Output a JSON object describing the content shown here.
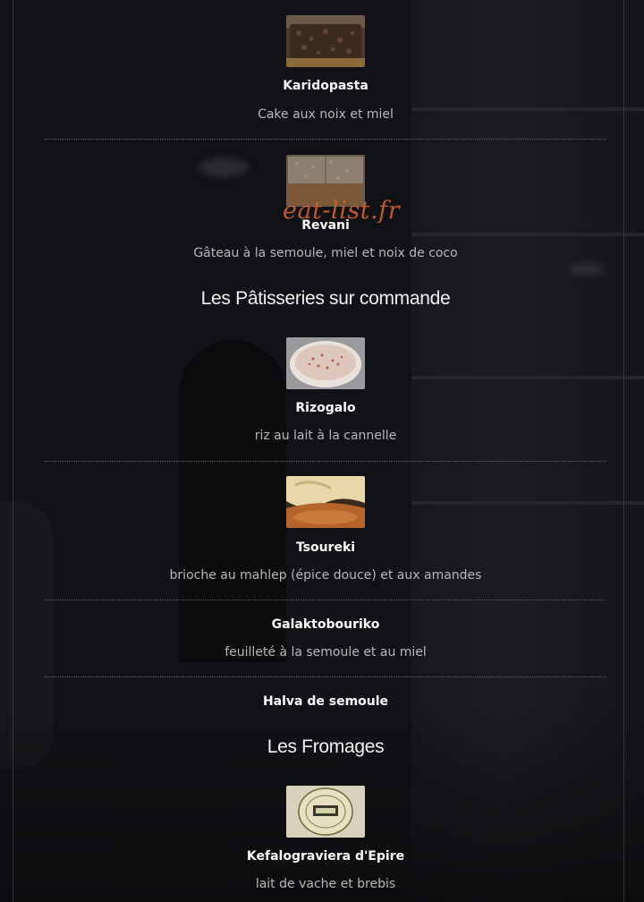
{
  "watermark": "eat-list.fr",
  "sections": [
    {
      "title": "Les Pâtisseries sur commande"
    },
    {
      "title": "Les Fromages"
    }
  ],
  "items": [
    {
      "name": "Karidopasta",
      "desc": "Cake aux noix et miel",
      "image": "walnut-cake-photo"
    },
    {
      "name": "Revani",
      "desc": "Gâteau à la semoule, miel et noix de coco",
      "image": "semolina-cake-photo"
    },
    {
      "name": "Rizogalo",
      "desc": "riz au lait à la cannelle",
      "image": "rice-pudding-photo"
    },
    {
      "name": "Tsoureki",
      "desc": "brioche au mahlep (épice douce) et aux amandes",
      "image": "brioche-photo"
    },
    {
      "name": "Galaktobouriko",
      "desc": "feuilleté à la semoule et au miel"
    },
    {
      "name": "Halva de semoule",
      "desc": ""
    },
    {
      "name": "Kefalograviera d'Epire",
      "desc": "lait de vache et brebis",
      "image": "cheese-photo"
    }
  ],
  "colors": {
    "background": "#111215",
    "text": "#ffffff",
    "muted_text": "#b7b7b9",
    "divider": "#5c5d62",
    "watermark": "#d4612b"
  }
}
